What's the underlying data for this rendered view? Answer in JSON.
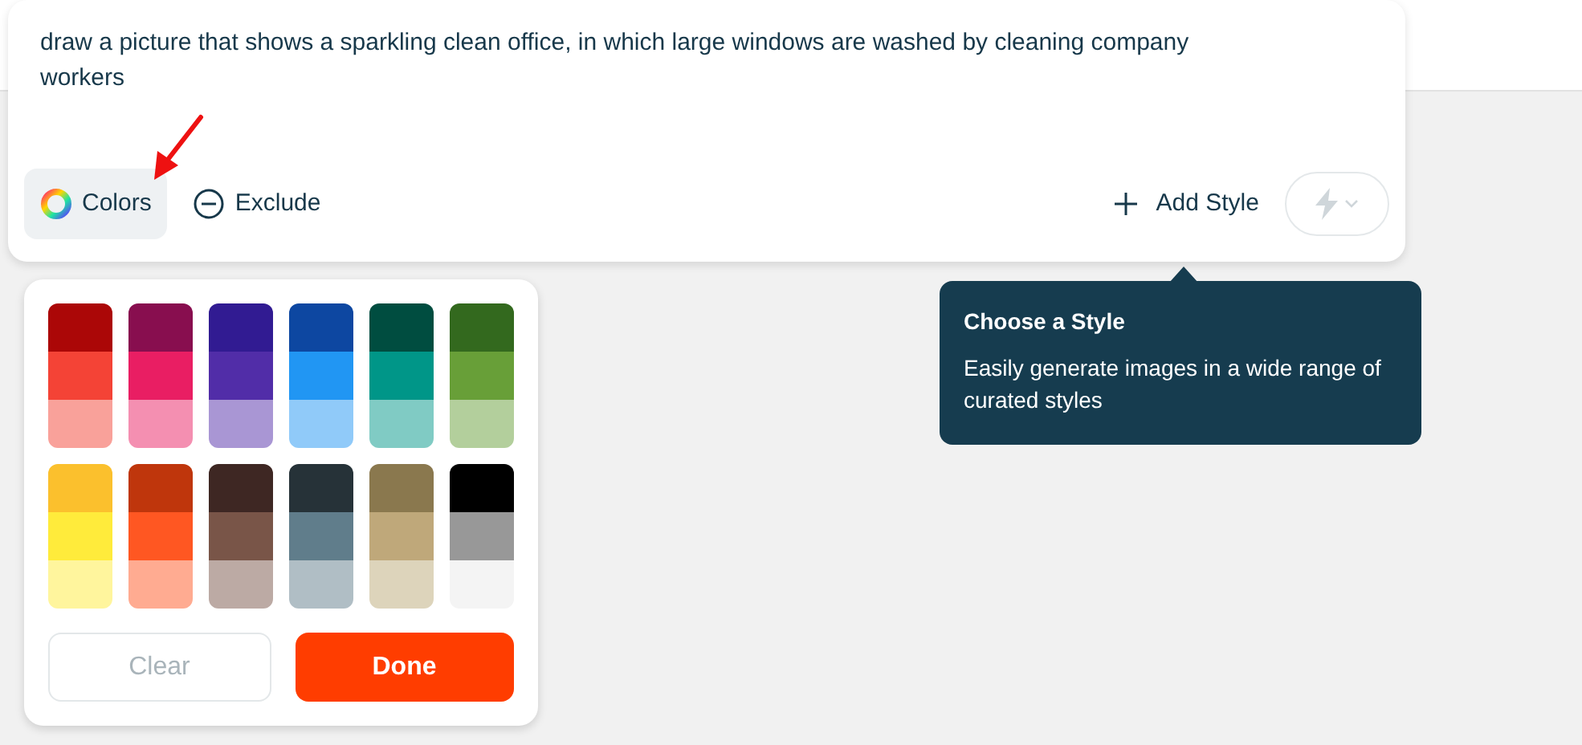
{
  "prompt": {
    "text": "draw a picture that shows a sparkling clean office, in which large windows are washed by cleaning company workers"
  },
  "toolbar": [
    {
      "label": "Colors",
      "kind": "colors",
      "selected": true
    },
    {
      "label": "Exclude",
      "kind": "exclude",
      "selected": false
    }
  ],
  "add_style": {
    "label": "Add Style"
  },
  "tooltip": {
    "title": "Choose a Style",
    "text": "Easily generate images in a wide range of curated styles"
  },
  "palettes": [
    {
      "shades": [
        {
          "color": "#ab0707"
        },
        {
          "color": "#f44336"
        },
        {
          "color": "#f9a19a"
        }
      ]
    },
    {
      "shades": [
        {
          "color": "#880e4f"
        },
        {
          "color": "#e91e63"
        },
        {
          "color": "#f48fb1"
        }
      ]
    },
    {
      "shades": [
        {
          "color": "#311b92"
        },
        {
          "color": "#512da8"
        },
        {
          "color": "#a996d4"
        }
      ]
    },
    {
      "shades": [
        {
          "color": "#0d47a1"
        },
        {
          "color": "#2196f3"
        },
        {
          "color": "#90caf9"
        }
      ]
    },
    {
      "shades": [
        {
          "color": "#004d40"
        },
        {
          "color": "#009688"
        },
        {
          "color": "#80cbc4"
        }
      ]
    },
    {
      "shades": [
        {
          "color": "#33691e"
        },
        {
          "color": "#689f38"
        },
        {
          "color": "#b3cf9c"
        }
      ]
    },
    {
      "shades": [
        {
          "color": "#fbc02d"
        },
        {
          "color": "#ffeb3b"
        },
        {
          "color": "#fff59d"
        }
      ]
    },
    {
      "shades": [
        {
          "color": "#bf360c"
        },
        {
          "color": "#ff5722"
        },
        {
          "color": "#ffab91"
        }
      ]
    },
    {
      "shades": [
        {
          "color": "#3e2723"
        },
        {
          "color": "#795548"
        },
        {
          "color": "#bcaaa4"
        }
      ]
    },
    {
      "shades": [
        {
          "color": "#263238"
        },
        {
          "color": "#607d8b"
        },
        {
          "color": "#b0bec5"
        }
      ]
    },
    {
      "shades": [
        {
          "color": "#8a784e"
        },
        {
          "color": "#bfa87a"
        },
        {
          "color": "#ddd4bb"
        }
      ]
    },
    {
      "shades": [
        {
          "color": "#000000"
        },
        {
          "color": "#989898"
        },
        {
          "color": "#f4f4f4"
        }
      ]
    }
  ],
  "buttons": [
    {
      "label": "Clear",
      "kind": "secondary",
      "disabled": true
    },
    {
      "label": "Done",
      "kind": "primary",
      "disabled": false
    }
  ]
}
